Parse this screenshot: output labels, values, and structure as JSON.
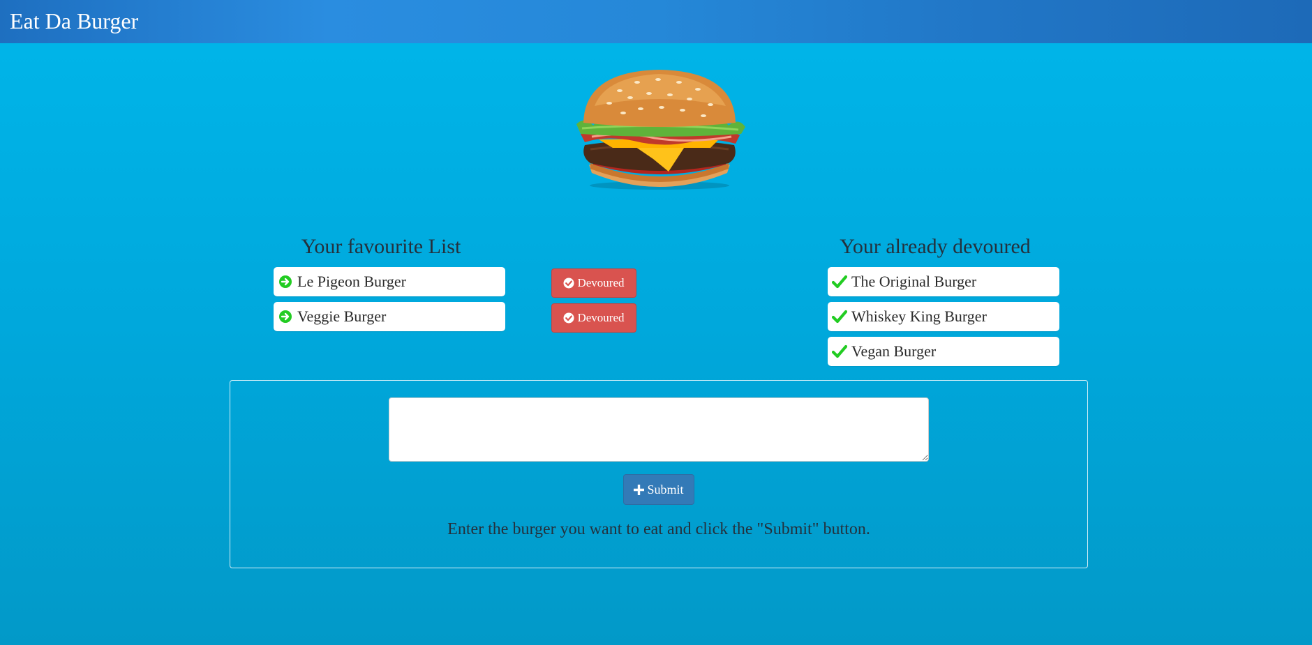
{
  "app": {
    "brand": "Eat Da Burger"
  },
  "hero": {
    "image": "burger-image"
  },
  "favourites": {
    "title": "Your favourite List",
    "icon": "arrow-circle-right-icon",
    "icon_color": "#22cc22",
    "items": [
      {
        "label": "Le Pigeon Burger",
        "action_label": "Devoured"
      },
      {
        "label": "Veggie Burger",
        "action_label": "Devoured"
      }
    ]
  },
  "devoured": {
    "title": "Your already devoured",
    "icon": "check-icon",
    "icon_color": "#22cc22",
    "items": [
      {
        "label": "The Original Burger"
      },
      {
        "label": "Whiskey King Burger"
      },
      {
        "label": "Vegan Burger"
      }
    ]
  },
  "form": {
    "input_value": "",
    "submit_label": "Submit",
    "submit_icon": "plus-icon",
    "instructions": "Enter the burger you want to eat and click the \"Submit\" button."
  },
  "colors": {
    "background": "#00aee2",
    "navbar": "#2588d8",
    "danger": "#d9534f",
    "primary": "#337ab7"
  }
}
